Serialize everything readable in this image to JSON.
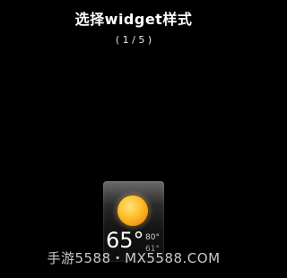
{
  "header": {
    "title": "选择widget样式",
    "page_indicator": "( 1 / 5 )"
  },
  "widget": {
    "icon": "sun-icon",
    "temperature": "65°",
    "high": "80°",
    "low": "61°",
    "colors": {
      "sun_center": "#ffd24a",
      "sun_edge": "#f29a12"
    }
  },
  "watermark": "手游5588・MX5588.COM"
}
